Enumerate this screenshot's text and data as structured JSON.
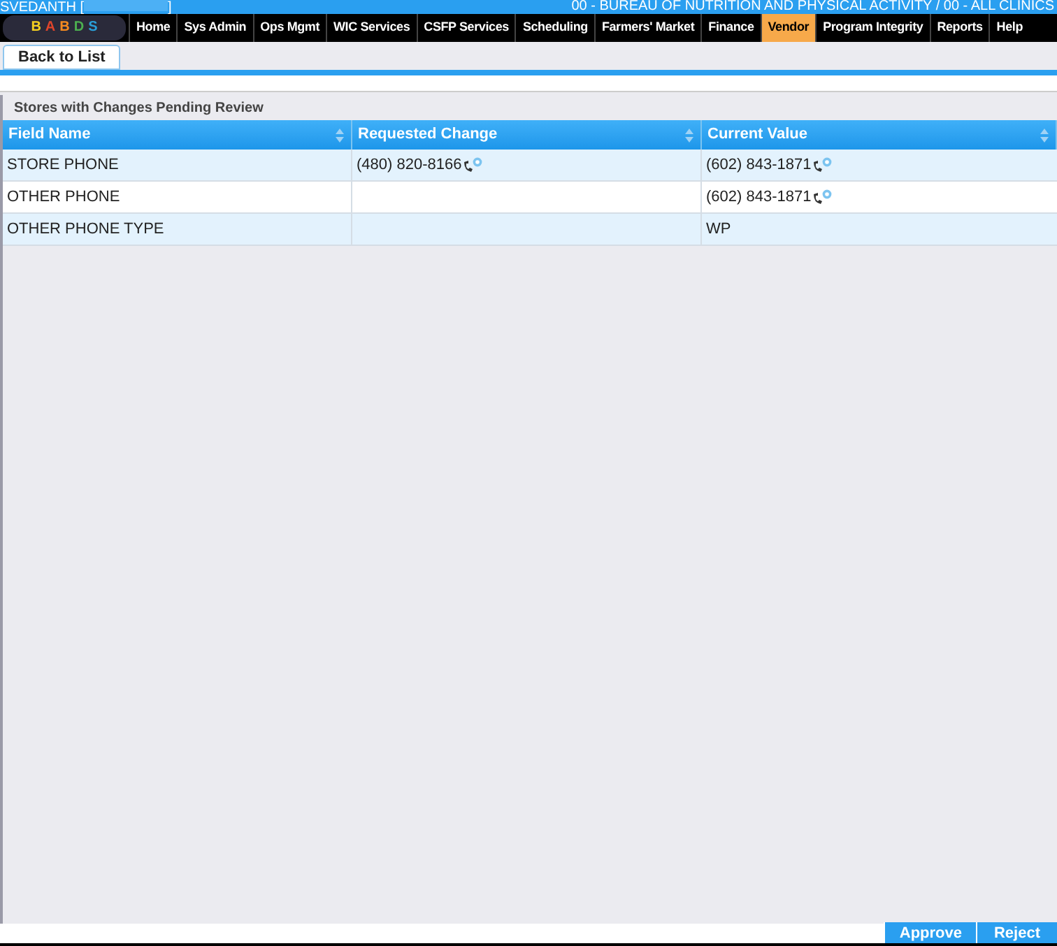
{
  "header": {
    "user": "SVEDANTH [",
    "user_suffix": "]",
    "agency": "00 - BUREAU OF NUTRITION AND PHYSICAL ACTIVITY / 00 - ALL CLINICS"
  },
  "logo": {
    "letters": [
      "B",
      "A",
      "B",
      "D",
      "S"
    ]
  },
  "nav": [
    {
      "label": "Home",
      "selected": false
    },
    {
      "label": "Sys Admin",
      "selected": false
    },
    {
      "label": "Ops Mgmt",
      "selected": false
    },
    {
      "label": "WIC Services",
      "selected": false
    },
    {
      "label": "CSFP Services",
      "selected": false
    },
    {
      "label": "Scheduling",
      "selected": false
    },
    {
      "label": "Farmers' Market",
      "selected": false
    },
    {
      "label": "Finance",
      "selected": false
    },
    {
      "label": "Vendor",
      "selected": true
    },
    {
      "label": "Program Integrity",
      "selected": false
    },
    {
      "label": "Reports",
      "selected": false
    },
    {
      "label": "Help",
      "selected": false
    }
  ],
  "back_button": "Back to List",
  "section_title": "Stores with Changes Pending Review",
  "table": {
    "columns": [
      "Field Name",
      "Requested Change",
      "Current Value"
    ],
    "rows": [
      {
        "cells": [
          {
            "kind": "text",
            "text": "STORE PHONE"
          },
          {
            "kind": "phone",
            "text": "(480) 820-8166"
          },
          {
            "kind": "phone",
            "text": "(602) 843-1871"
          }
        ]
      },
      {
        "cells": [
          {
            "kind": "text",
            "text": "OTHER PHONE"
          },
          null,
          {
            "kind": "phone",
            "text": "(602) 843-1871"
          }
        ]
      },
      {
        "cells": [
          {
            "kind": "text",
            "text": "OTHER PHONE TYPE"
          },
          null,
          {
            "kind": "text",
            "text": "WP"
          }
        ]
      }
    ]
  },
  "buttons": [
    "Approve",
    "Reject"
  ]
}
